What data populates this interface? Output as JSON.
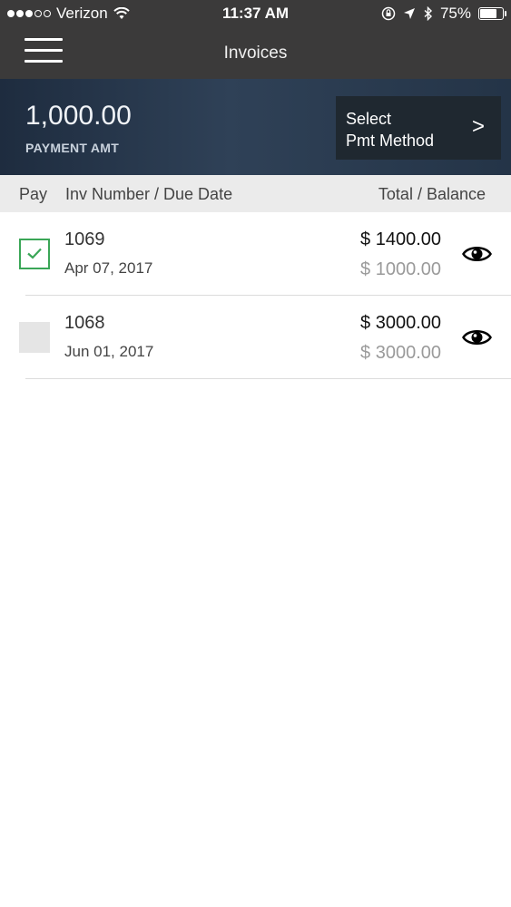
{
  "status_bar": {
    "carrier": "Verizon",
    "time": "11:37 AM",
    "battery": "75%",
    "signal_bars_filled": 3,
    "signal_bars_total": 5,
    "battery_level": 0.75
  },
  "nav": {
    "title": "Invoices"
  },
  "payment": {
    "amount": "1,000.00",
    "label": "PAYMENT AMT",
    "select_line1": "Select",
    "select_line2": "Pmt Method",
    "chevron": ">"
  },
  "table": {
    "headers": {
      "pay": "Pay",
      "inv": "Inv Number / Due Date",
      "total": "Total / Balance"
    },
    "rows": [
      {
        "number": "1069",
        "due_date": "Apr 07, 2017",
        "total": "$ 1400.00",
        "balance": "$ 1000.00",
        "checked": true
      },
      {
        "number": "1068",
        "due_date": "Jun 01, 2017",
        "total": "$ 3000.00",
        "balance": "$ 3000.00",
        "checked": false
      }
    ]
  },
  "colors": {
    "nav_bg": "#3b3a3a",
    "check_green": "#3aa657",
    "button_bg": "#1f2830"
  },
  "icons": {
    "menu": "hamburger-menu-icon",
    "view": "eye-icon",
    "wifi": "wifi-icon",
    "location": "location-arrow-icon",
    "bluetooth": "bluetooth-icon",
    "lock": "orientation-lock-icon"
  }
}
